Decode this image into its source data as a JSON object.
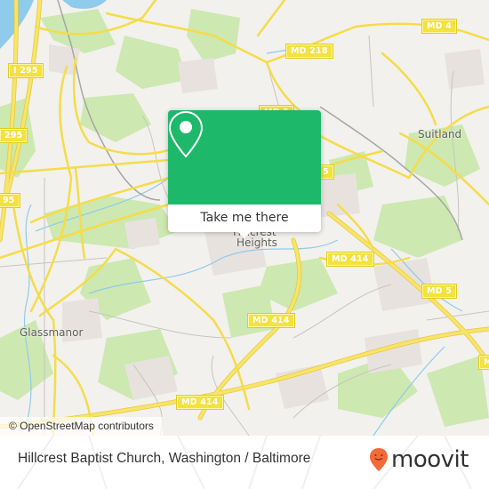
{
  "map": {
    "colors": {
      "background": "#f2f1ee",
      "road": "#f5dc4a",
      "road_casing": "#e8c935",
      "park": "#cde8b0",
      "residential": "#e8e2df",
      "water": "#8fcbea",
      "rail": "#9a9a9a",
      "minor_road": "#bfbfbf"
    },
    "route_shields": [
      {
        "id": "i295-a",
        "label": "I 295"
      },
      {
        "id": "i295-b",
        "label": "295"
      },
      {
        "id": "i295-c",
        "label": "95"
      },
      {
        "id": "md4",
        "label": "MD 4"
      },
      {
        "id": "md218",
        "label": "MD 218"
      },
      {
        "id": "md5-top",
        "label": "MD 5"
      },
      {
        "id": "md5-mid",
        "label": "5"
      },
      {
        "id": "md414-a",
        "label": "MD 414"
      },
      {
        "id": "md414-b",
        "label": "MD 414"
      },
      {
        "id": "md414-c",
        "label": "MD 414"
      },
      {
        "id": "md5-right",
        "label": "MD 5"
      },
      {
        "id": "edge-right",
        "label": "M"
      }
    ],
    "place_labels": [
      {
        "id": "suitland",
        "label": "Suitland"
      },
      {
        "id": "glassmanor",
        "label": "Glassmanor"
      },
      {
        "id": "hillcrest-heights-1",
        "label": "Hillcrest"
      },
      {
        "id": "hillcrest-heights-2",
        "label": "Heights"
      }
    ],
    "attribution": "© OpenStreetMap contributors"
  },
  "popup": {
    "icon": "location-pin-icon",
    "accent": "#1db86a",
    "button_label": "Take me there"
  },
  "footer": {
    "title": "Hillcrest Baptist Church, Washington / Baltimore",
    "brand": {
      "name": "moovit",
      "icon": "moovit-pin-smile-icon",
      "color": "#f26a3a"
    }
  }
}
